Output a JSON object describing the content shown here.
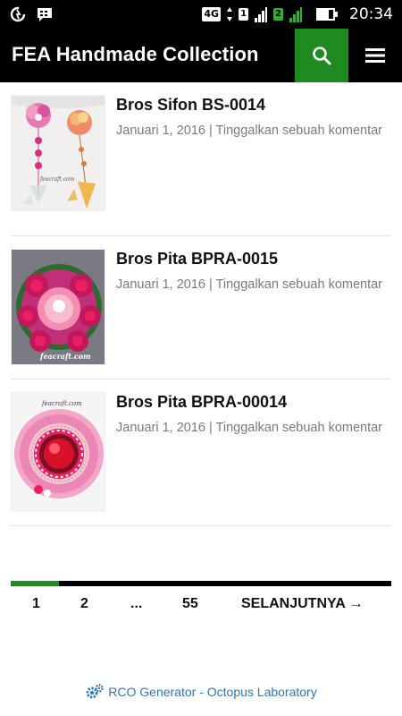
{
  "status_bar": {
    "time": "20:34",
    "network": "4G",
    "sim1": "1",
    "sim2": "2",
    "icons": [
      "data-saver-icon",
      "bbm-icon",
      "signal-icon",
      "battery-icon"
    ]
  },
  "header": {
    "title": "FEA Handmade Collection",
    "search_icon": "search-icon",
    "menu_icon": "hamburger-menu-icon",
    "accent_color": "#1f8a1f"
  },
  "posts": [
    {
      "title": "Bros Sifon BS-0014",
      "date": "Januari 1, 2016",
      "separator": "|",
      "comment_link": "Tinggalkan sebuah komentar",
      "watermark": "feacraft.com"
    },
    {
      "title": "Bros Pita BPRA-0015",
      "date": "Januari 1, 2016",
      "separator": "|",
      "comment_link": "Tinggalkan sebuah komentar",
      "watermark": "feacraft.com"
    },
    {
      "title": "Bros Pita BPRA-00014",
      "date": "Januari 1, 2016",
      "separator": "|",
      "comment_link": "Tinggalkan sebuah komentar",
      "watermark": "feacraft.com"
    }
  ],
  "pagination": {
    "pages": [
      "1",
      "2",
      "...",
      "55"
    ],
    "current": "1",
    "next": "SELANJUTNYA →"
  },
  "footer": {
    "link_text": "RCO Generator - Octopus Laboratory",
    "icon": "gears-icon"
  }
}
